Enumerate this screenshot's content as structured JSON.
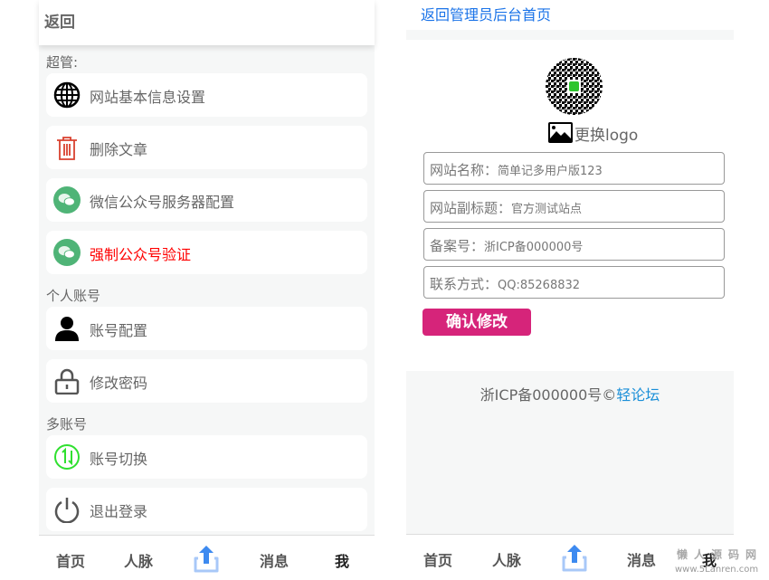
{
  "left": {
    "back": "返回",
    "sections": [
      {
        "title": "超管:"
      },
      {
        "title": "个人账号"
      },
      {
        "title": "多账号"
      }
    ],
    "items": [
      {
        "label": "网站基本信息设置",
        "icon": "globe-icon"
      },
      {
        "label": "删除文章",
        "icon": "trash-icon"
      },
      {
        "label": "微信公众号服务器配置",
        "icon": "wechat-icon"
      },
      {
        "label": "强制公众号验证",
        "icon": "wechat-icon",
        "color": "#ff0000"
      },
      {
        "label": "账号配置",
        "icon": "user-icon"
      },
      {
        "label": "修改密码",
        "icon": "lock-icon"
      },
      {
        "label": "账号切换",
        "icon": "switch-icon"
      },
      {
        "label": "退出登录",
        "icon": "power-icon"
      }
    ]
  },
  "nav": {
    "home": "首页",
    "contacts": "人脉",
    "messages": "消息",
    "me": "我"
  },
  "right": {
    "back_link": "返回管理员后台首页",
    "change_logo": "更换logo",
    "fields": [
      {
        "label": "网站名称：",
        "value": "简单记多用户版123"
      },
      {
        "label": "网站副标题：",
        "value": "官方测试站点"
      },
      {
        "label": "备案号：",
        "value": "浙ICP备000000号"
      },
      {
        "label": "联系方式：",
        "value": "QQ:85268832"
      }
    ],
    "submit": "确认修改",
    "footer_text": "浙ICP备000000号©",
    "footer_link": "轻论坛"
  },
  "watermark": {
    "name": "懒人源码网",
    "url": "www.5Lanren.com"
  },
  "colors": {
    "accent": "#d6247a",
    "link": "#1a73e8",
    "wechat": "#4fb477"
  }
}
